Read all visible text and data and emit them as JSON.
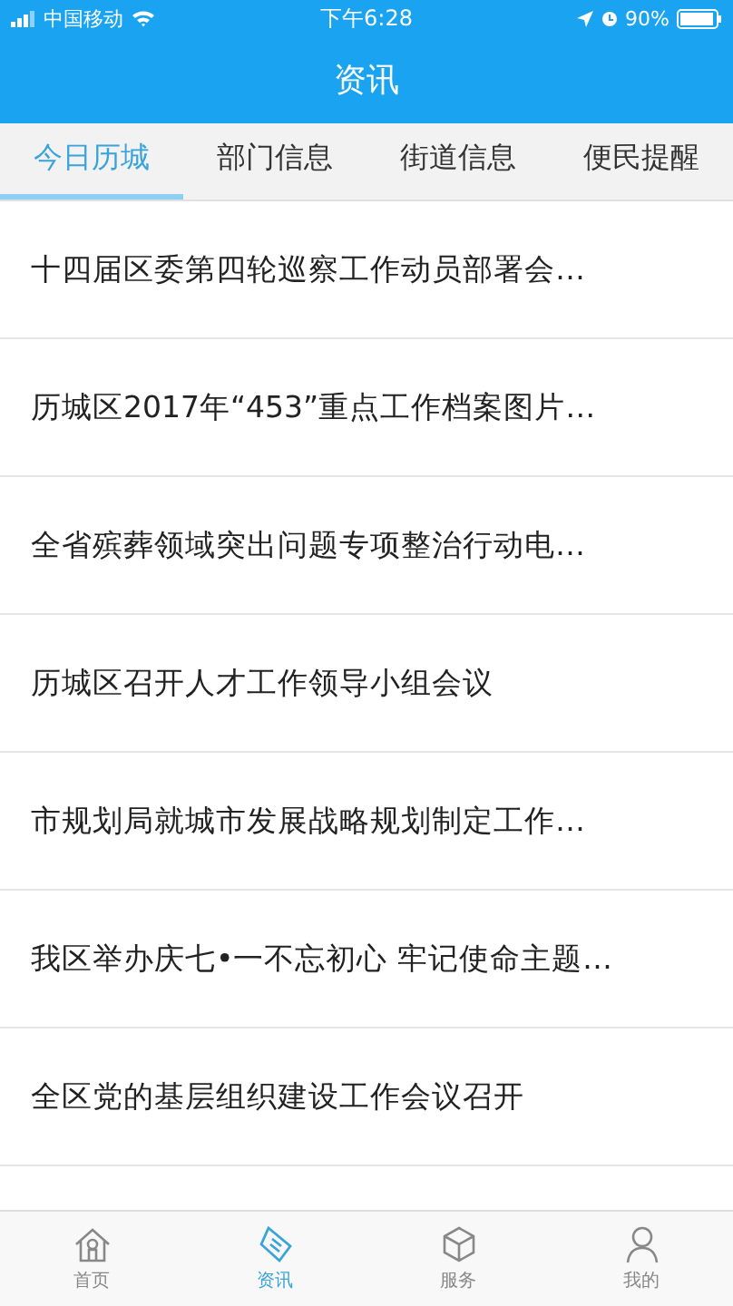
{
  "status_bar": {
    "carrier": "中国移动",
    "time": "下午6:28",
    "battery": "90%"
  },
  "title": "资讯",
  "tabs": [
    {
      "label": "今日历城",
      "selected": true
    },
    {
      "label": "部门信息",
      "selected": false
    },
    {
      "label": "街道信息",
      "selected": false
    },
    {
      "label": "便民提醒",
      "selected": false
    }
  ],
  "news": [
    "十四届区委第四轮巡察工作动员部署会…",
    "历城区2017年“453”重点工作档案图片…",
    "全省殡葬领域突出问题专项整治行动电…",
    "历城区召开人才工作领导小组会议",
    "市规划局就城市发展战略规划制定工作…",
    "我区举办庆七•一不忘初心 牢记使命主题…",
    "全区党的基层组织建设工作会议召开"
  ],
  "bottom_nav": [
    {
      "label": "首页",
      "kind": "home",
      "selected": false
    },
    {
      "label": "资讯",
      "kind": "news",
      "selected": true
    },
    {
      "label": "服务",
      "kind": "service",
      "selected": false
    },
    {
      "label": "我的",
      "kind": "me",
      "selected": false
    }
  ]
}
